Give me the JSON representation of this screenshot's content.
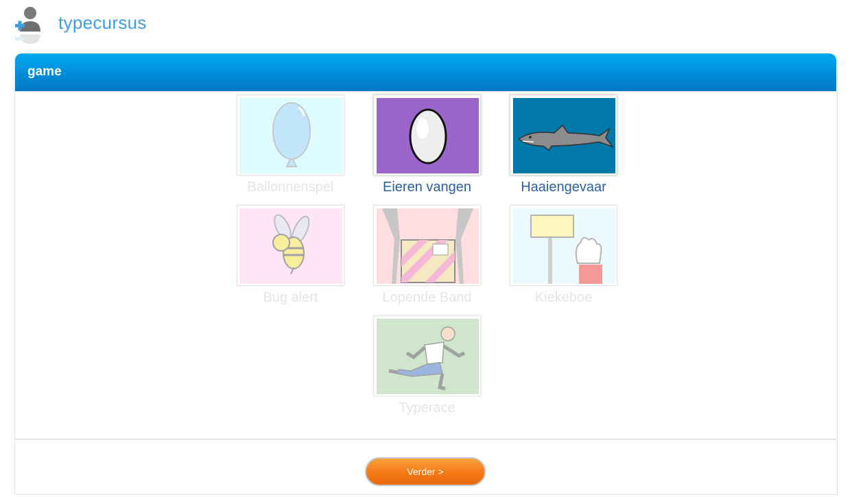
{
  "app": {
    "title": "typecursus"
  },
  "panel": {
    "title": "game"
  },
  "games": [
    {
      "label": "Ballonnenspel",
      "enabled": false
    },
    {
      "label": "Eieren vangen",
      "enabled": true
    },
    {
      "label": "Haaiengevaar",
      "enabled": true
    },
    {
      "label": "Bug alert",
      "enabled": false
    },
    {
      "label": "Lopende Band",
      "enabled": false
    },
    {
      "label": "Kiekeboe",
      "enabled": false
    },
    {
      "label": "Typerace",
      "enabled": false
    }
  ],
  "footer": {
    "next_label": "Verder >"
  },
  "colors": {
    "accent": "#0089d6",
    "brand": "#3d9ee0",
    "button": "#f47a16",
    "active_label": "#2c5f9e"
  }
}
